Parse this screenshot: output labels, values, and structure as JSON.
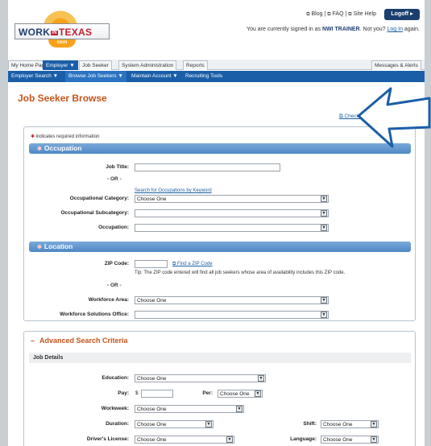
{
  "header": {
    "logo": {
      "top": "WORK",
      "mid": "IN",
      "right": "TEXAS",
      "com": "com"
    },
    "links": {
      "blog": "Blog",
      "faq": "FAQ",
      "site_help": "Site Help",
      "sep": "|"
    },
    "logoff_label": "Logoff",
    "signed_prefix": "You are currently signed in as ",
    "signed_user": "NWI TRAINER",
    "signed_mid": ". Not you? ",
    "signed_link": "Log In",
    "signed_suffix": " again."
  },
  "tabs": [
    {
      "label": "My Home Page"
    },
    {
      "label": "Employer ▼"
    },
    {
      "label": "Job Seeker"
    },
    {
      "label": "System Administration"
    },
    {
      "label": "Reports"
    },
    {
      "label": "Messages & Alerts"
    }
  ],
  "subnav": [
    {
      "label": "Employer Search ▼"
    },
    {
      "label": "Browse Job Seekers ▼"
    },
    {
      "label": "Maintain Account ▼"
    },
    {
      "label": "Recruiting Tools"
    }
  ],
  "page_title": "Job Seeker Browse",
  "check_link": "Check Labor",
  "required_note": "indicates required information",
  "occupation": {
    "heading": "Occupation",
    "job_title_label": "Job Title:",
    "or": "- OR -",
    "keyword_link": "Search for Occupations by Keyword",
    "category_label": "Occupational Category:",
    "category_value": "Choose One",
    "subcategory_label": "Occupational Subcategory:",
    "occupation_label": "Occupation:"
  },
  "location": {
    "heading": "Location",
    "zip_label": "ZIP Code:",
    "find_zip_link": "Find a ZIP Code",
    "tip": "Tip: The ZIP code entered will find all job seekers whose area of availability includes this ZIP code.",
    "or": "- OR -",
    "workforce_area_label": "Workforce Area:",
    "workforce_area_value": "Choose One",
    "office_label": "Workforce Solutions Office:"
  },
  "advanced": {
    "heading": "Advanced Search Criteria",
    "minus": "–",
    "job_details": "Job Details",
    "education_label": "Education:",
    "education_value": "Choose One",
    "pay_label": "Pay:",
    "pay_prefix": "$",
    "per_label": "Per:",
    "per_value": "Choose One",
    "workweek_label": "Workweek:",
    "workweek_value": "Choose One",
    "duration_label": "Duration:",
    "duration_value": "Choose One",
    "shift_label": "Shift:",
    "shift_value": "Choose One",
    "license_label": "Driver's License:",
    "license_value": "Choose One",
    "language_label": "Language:",
    "language_value": "Choose One"
  },
  "colors": {
    "accent": "#1a5ea8",
    "title": "#c4541a",
    "arrow": "#1a5ea8"
  }
}
